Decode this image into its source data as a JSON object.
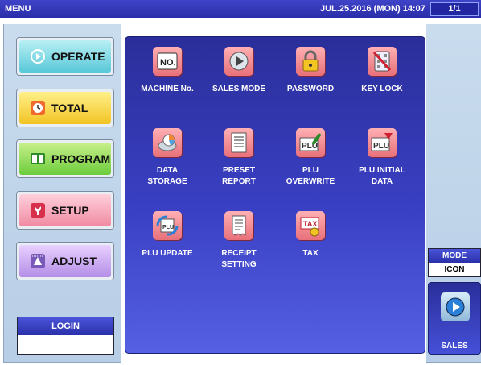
{
  "topbar": {
    "title": "MENU",
    "datetime": "JUL.25.2016 (MON) 14:07",
    "page": "1/1"
  },
  "sidebar": {
    "buttons": [
      {
        "label": "OPERATE",
        "icon": "play-circle-icon"
      },
      {
        "label": "TOTAL",
        "icon": "clock-icon"
      },
      {
        "label": "PROGRAM",
        "icon": "book-icon"
      },
      {
        "label": "SETUP",
        "icon": "wrench-icon"
      },
      {
        "label": "ADJUST",
        "icon": "adjust-scale-icon"
      }
    ],
    "login_label": "LOGIN",
    "login_value": ""
  },
  "main": {
    "tiles": [
      {
        "label": "MACHINE No.",
        "icon": "machine-number-icon"
      },
      {
        "label": "SALES MODE",
        "icon": "sales-mode-icon"
      },
      {
        "label": "PASSWORD",
        "icon": "padlock-icon"
      },
      {
        "label": "KEY LOCK",
        "icon": "key-lock-icon"
      },
      {
        "label": "DATA\nSTORAGE",
        "icon": "data-storage-icon"
      },
      {
        "label": "PRESET\nREPORT",
        "icon": "preset-report-icon"
      },
      {
        "label": "PLU\nOVERWRITE",
        "icon": "plu-overwrite-icon"
      },
      {
        "label": "PLU INITIAL\nDATA",
        "icon": "plu-initial-data-icon"
      },
      {
        "label": "PLU UPDATE",
        "icon": "plu-update-icon"
      },
      {
        "label": "RECEIPT\nSETTING",
        "icon": "receipt-setting-icon"
      },
      {
        "label": "TAX",
        "icon": "tax-icon"
      }
    ]
  },
  "right": {
    "mode_label": "MODE",
    "mode_value": "ICON",
    "sales_label": "SALES"
  },
  "colors": {
    "topbar": "#2a2ea8",
    "panel": "#c9dcee",
    "main": "#3a40c4"
  }
}
